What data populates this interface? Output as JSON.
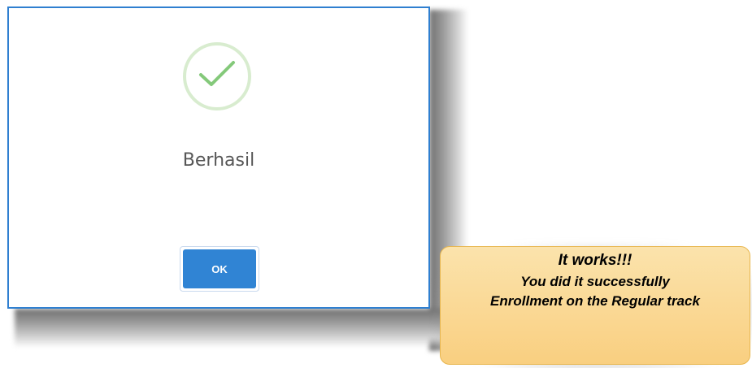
{
  "dialog": {
    "icon": "checkmark-icon",
    "title": "Berhasil",
    "ok_label": "OK",
    "border_color": "#2f7fd0",
    "button_color": "#3084d4",
    "check_color": "#84c97a"
  },
  "note": {
    "line1": "It works!!!",
    "line2": "You did it successfully",
    "line3": "Enrollment on the Regular track",
    "background_color": "#fad894"
  }
}
